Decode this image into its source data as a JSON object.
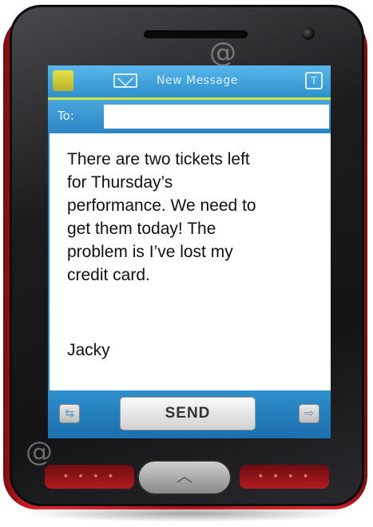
{
  "colors": {
    "casing": "#c81a22",
    "bezel": "#1c1c1f",
    "screen_header": "#2f8fcc",
    "header_accent": "#cfe53c",
    "message_background": "#ffffff"
  },
  "icons": {
    "status": "battery-icon",
    "envelope": "envelope-icon",
    "antenna": "antenna-icon",
    "left_arrow": "left-arrow-icon",
    "right_arrow": "right-arrow-icon",
    "home": "chevron-up-icon"
  },
  "screen": {
    "title": "New Message",
    "to_label": "To:",
    "to_value": "",
    "message_text": "There are two tickets left\nfor Thursday’s\nperformance. We need to\nget them today! The\nproblem is I’ve lost my\ncredit card.",
    "signature": "Jacky",
    "send_label": "SEND"
  }
}
